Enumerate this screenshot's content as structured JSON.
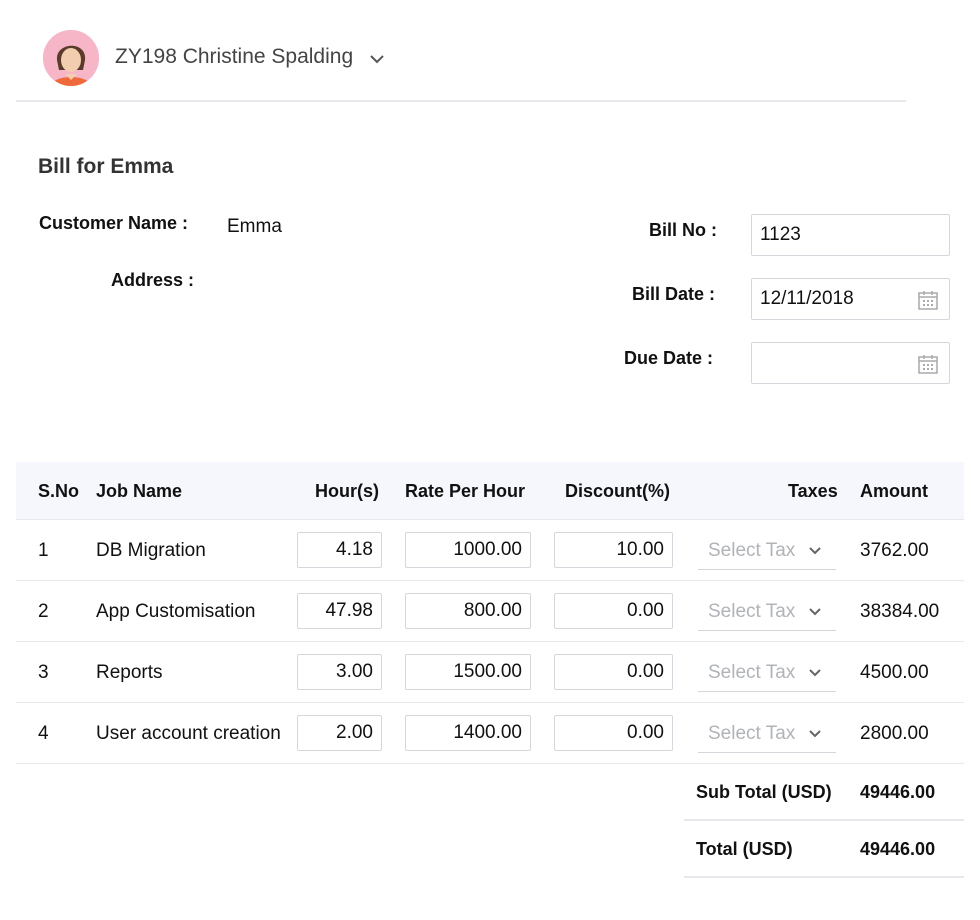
{
  "header": {
    "user_name": "ZY198 Christine Spalding"
  },
  "bill": {
    "title": "Bill for Emma",
    "customer_name_label": "Customer Name :",
    "customer_name": "Emma",
    "address_label": "Address :",
    "bill_no_label": "Bill No :",
    "bill_no": "1123",
    "bill_date_label": "Bill Date :",
    "bill_date": "12/11/2018",
    "due_date_label": "Due Date :",
    "due_date": ""
  },
  "table": {
    "headers": {
      "sno": "S.No",
      "job": "Job Name",
      "hours": "Hour(s)",
      "rate": "Rate Per Hour",
      "discount": "Discount(%)",
      "taxes": "Taxes",
      "amount": "Amount"
    },
    "rows": [
      {
        "sno": "1",
        "job": "DB Migration",
        "hours": "4.18",
        "rate": "1000.00",
        "discount": "10.00",
        "tax": "Select Tax",
        "amount": "3762.00"
      },
      {
        "sno": "2",
        "job": "App Customisation",
        "hours": "47.98",
        "rate": "800.00",
        "discount": "0.00",
        "tax": "Select Tax",
        "amount": "38384.00"
      },
      {
        "sno": "3",
        "job": "Reports",
        "hours": "3.00",
        "rate": "1500.00",
        "discount": "0.00",
        "tax": "Select Tax",
        "amount": "4500.00"
      },
      {
        "sno": "4",
        "job": "User account creation",
        "hours": "2.00",
        "rate": "1400.00",
        "discount": "0.00",
        "tax": "Select Tax",
        "amount": "2800.00"
      }
    ]
  },
  "totals": {
    "subtotal_label": "Sub Total (USD)",
    "subtotal": "49446.00",
    "total_label": "Total (USD)",
    "total": "49446.00"
  },
  "icons": {
    "user_dropdown": "chevron-down-icon",
    "calendar": "calendar-icon",
    "tax_dropdown": "chevron-down-icon"
  },
  "colors": {
    "header_bg": "#f5f7fc",
    "border": "#e6e8ec",
    "placeholder": "#b0b3b8",
    "avatar_bg": "#f7b6c8"
  }
}
